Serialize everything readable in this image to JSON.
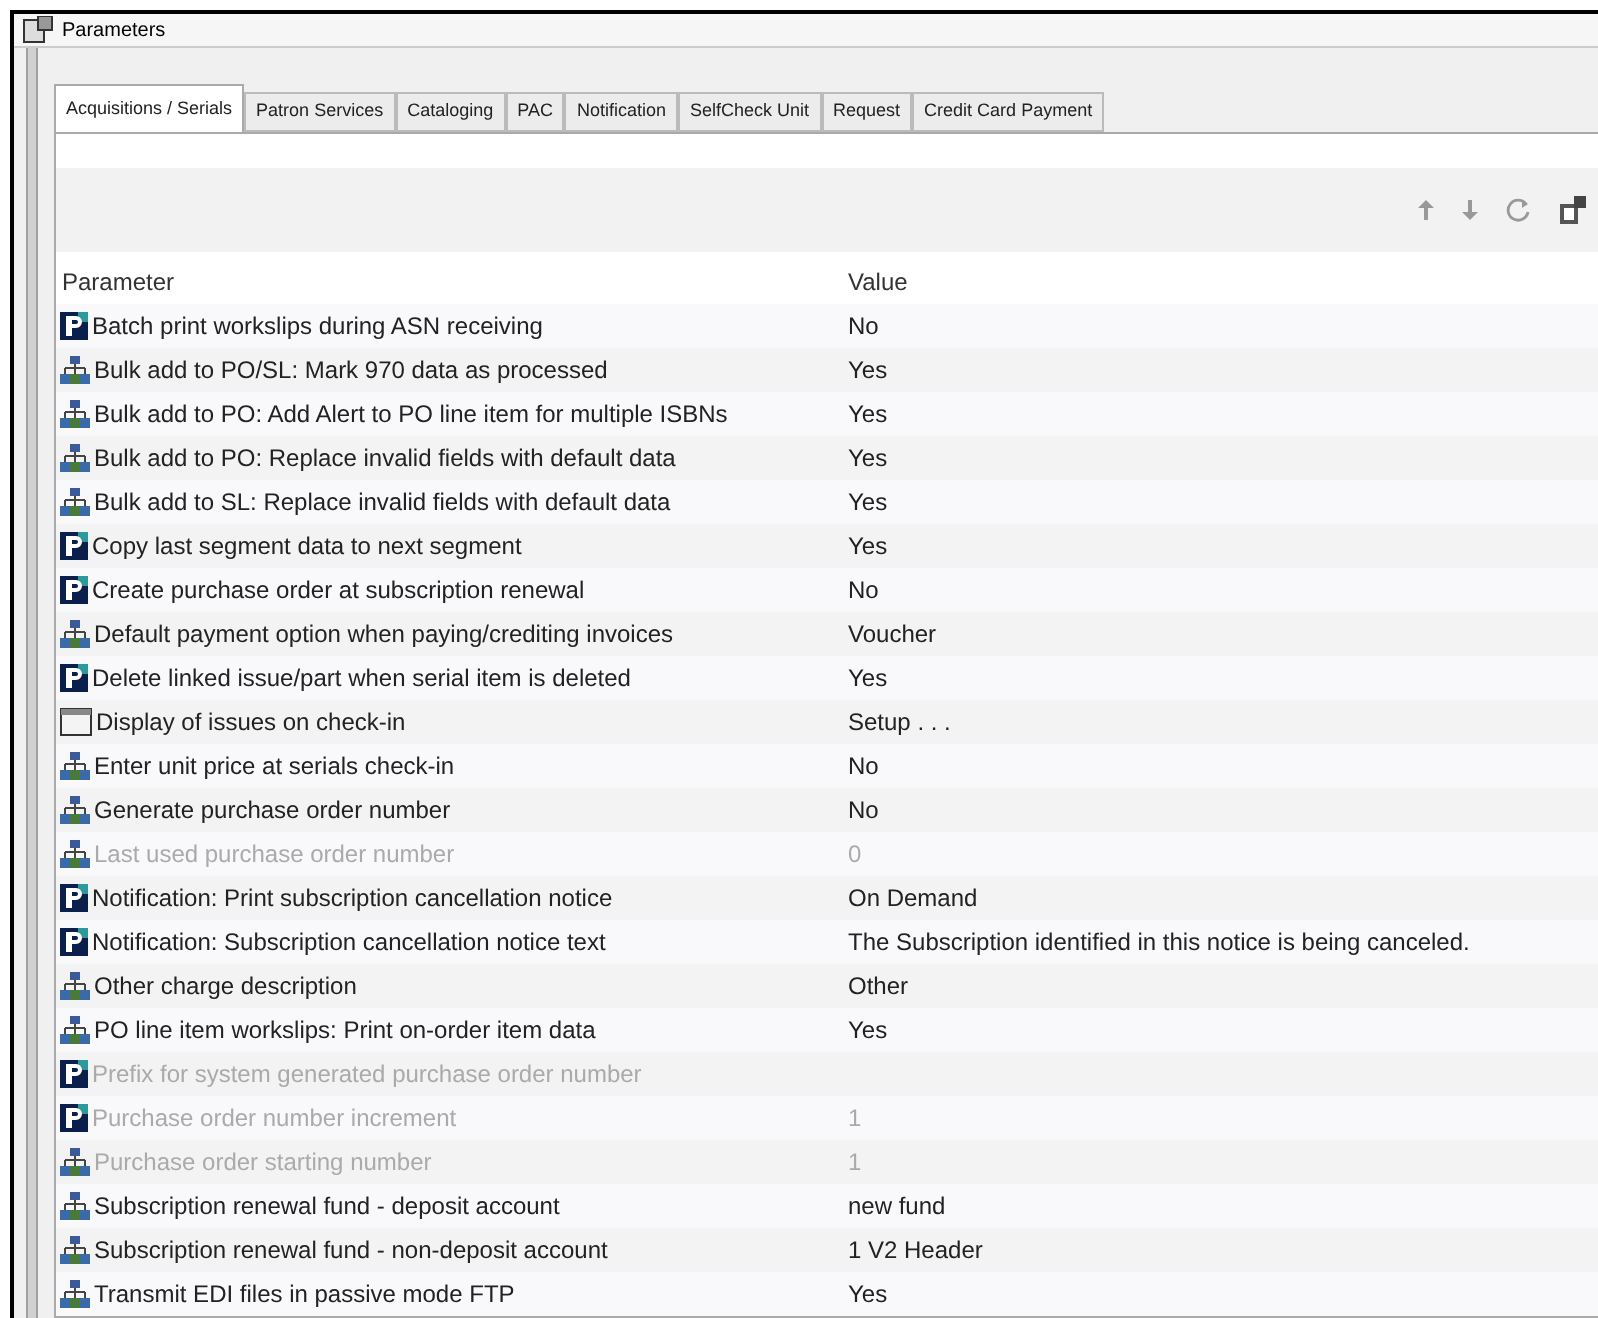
{
  "window": {
    "title": "Parameters"
  },
  "tabs": [
    {
      "label": "Acquisitions / Serials",
      "selected": true
    },
    {
      "label": "Patron Services",
      "selected": false
    },
    {
      "label": "Cataloging",
      "selected": false
    },
    {
      "label": "PAC",
      "selected": false
    },
    {
      "label": "Notification",
      "selected": false
    },
    {
      "label": "SelfCheck Unit",
      "selected": false
    },
    {
      "label": "Request",
      "selected": false
    },
    {
      "label": "Credit Card Payment",
      "selected": false
    }
  ],
  "table": {
    "columns": [
      "Parameter",
      "Value"
    ],
    "rows": [
      {
        "kind": "p",
        "name": "Batch print workslips during ASN receiving",
        "value": "No",
        "disabled": false
      },
      {
        "kind": "org",
        "name": "Bulk add to PO/SL: Mark 970 data as processed",
        "value": "Yes",
        "disabled": false
      },
      {
        "kind": "org",
        "name": "Bulk add to PO: Add Alert to PO line item for multiple ISBNs",
        "value": "Yes",
        "disabled": false
      },
      {
        "kind": "org",
        "name": "Bulk add to PO: Replace invalid fields with default data",
        "value": "Yes",
        "disabled": false
      },
      {
        "kind": "org",
        "name": "Bulk add to SL: Replace invalid fields with default data",
        "value": "Yes",
        "disabled": false
      },
      {
        "kind": "p",
        "name": "Copy last segment data to next segment",
        "value": "Yes",
        "disabled": false
      },
      {
        "kind": "p",
        "name": "Create purchase order at subscription renewal",
        "value": "No",
        "disabled": false
      },
      {
        "kind": "org",
        "name": "Default payment option when paying/crediting invoices",
        "value": "Voucher",
        "disabled": false
      },
      {
        "kind": "p",
        "name": "Delete linked issue/part when serial item is deleted",
        "value": "Yes",
        "disabled": false
      },
      {
        "kind": "setup",
        "name": "Display of issues on check-in",
        "value": "Setup . . .",
        "disabled": false
      },
      {
        "kind": "org",
        "name": "Enter unit price at serials check-in",
        "value": "No",
        "disabled": false
      },
      {
        "kind": "org",
        "name": "Generate purchase order number",
        "value": "No",
        "disabled": false
      },
      {
        "kind": "org",
        "name": "Last used purchase order number",
        "value": "0",
        "disabled": true
      },
      {
        "kind": "p",
        "name": "Notification: Print subscription cancellation notice",
        "value": "On Demand",
        "disabled": false
      },
      {
        "kind": "p",
        "name": "Notification: Subscription cancellation notice text",
        "value": "The Subscription identified in this notice is being canceled.",
        "disabled": false
      },
      {
        "kind": "org",
        "name": "Other charge description",
        "value": "Other",
        "disabled": false
      },
      {
        "kind": "org",
        "name": "PO line item workslips: Print on-order item data",
        "value": "Yes",
        "disabled": false
      },
      {
        "kind": "p",
        "name": "Prefix for system generated purchase order number",
        "disabled": true
      },
      {
        "kind": "p",
        "name": "Purchase order number increment",
        "value": "1",
        "disabled": true
      },
      {
        "kind": "org",
        "name": "Purchase order starting number",
        "value": "1",
        "disabled": true
      },
      {
        "kind": "org",
        "name": "Subscription renewal fund - deposit account",
        "value": "new fund",
        "disabled": false
      },
      {
        "kind": "org",
        "name": "Subscription renewal fund - non-deposit account",
        "value": "1 V2 Header",
        "disabled": false
      },
      {
        "kind": "org",
        "name": "Transmit EDI files in passive mode FTP",
        "value": "Yes",
        "disabled": false
      }
    ]
  }
}
